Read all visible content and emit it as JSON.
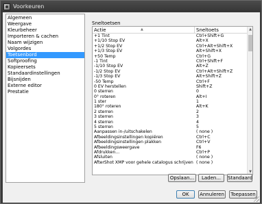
{
  "window": {
    "title": "Voorkeuren"
  },
  "sidebar": {
    "items": [
      {
        "label": "Algemeen"
      },
      {
        "label": "Weergave"
      },
      {
        "label": "Kleurbeheer"
      },
      {
        "label": "Importeren & cachen"
      },
      {
        "label": "Naam wijzigen"
      },
      {
        "label": "Volgordes"
      },
      {
        "label": "Toetsenbord",
        "selected": true
      },
      {
        "label": "Softproofing"
      },
      {
        "label": "Kopieersets"
      },
      {
        "label": "Standaardinstellingen"
      },
      {
        "label": "Bijsnijden"
      },
      {
        "label": "Externe editor"
      },
      {
        "label": "Prestatie"
      }
    ]
  },
  "main": {
    "section_title": "Sneltoetsen",
    "table": {
      "headers": {
        "action": "Actie",
        "shortcut": "Sneltoets"
      },
      "rows": [
        {
          "action": "+1 Tint",
          "shortcut": "Ctrl+Shift+G"
        },
        {
          "action": "+1/10 Stop EV",
          "shortcut": "Alt+X"
        },
        {
          "action": "+1/2 Stop EV",
          "shortcut": "Ctrl+Alt+Shift+X"
        },
        {
          "action": "+1/3 Stop EV",
          "shortcut": "Alt+Shift+X"
        },
        {
          "action": "+50 Temp",
          "shortcut": "Ctrl+G"
        },
        {
          "action": "-1 Tint",
          "shortcut": "Ctrl+Shift+F"
        },
        {
          "action": "-1/10 Stop EV",
          "shortcut": "Alt+Z"
        },
        {
          "action": "-1/2 Stop EV",
          "shortcut": "Ctrl+Alt+Shift+Z"
        },
        {
          "action": "-1/3 Stop EV",
          "shortcut": "Alt+Shift+Z"
        },
        {
          "action": "-50 Temp",
          "shortcut": "Ctrl+F"
        },
        {
          "action": "0 EV herstellen",
          "shortcut": "Shift+Z"
        },
        {
          "action": "0 sterren",
          "shortcut": "0"
        },
        {
          "action": "0° roteren",
          "shortcut": "Alt+I"
        },
        {
          "action": "1 ster",
          "shortcut": "1"
        },
        {
          "action": "180° roteren",
          "shortcut": "Alt+K"
        },
        {
          "action": "2 sterren",
          "shortcut": "2"
        },
        {
          "action": "3 sterren",
          "shortcut": "3"
        },
        {
          "action": "4 sterren",
          "shortcut": "4"
        },
        {
          "action": "5 sterren",
          "shortcut": "5"
        },
        {
          "action": "Aanpassen in-/uitschakelen",
          "shortcut": "( none )"
        },
        {
          "action": "Afbeeldingsinstellingen kopiëren",
          "shortcut": "Ctrl+C"
        },
        {
          "action": "Afbeeldingsinstellingen plakken",
          "shortcut": "Ctrl+V"
        },
        {
          "action": "Afbeeldingsweergave",
          "shortcut": "F6"
        },
        {
          "action": "Afdrukken...",
          "shortcut": "Ctrl+P"
        },
        {
          "action": "Afsluiten",
          "shortcut": "( none )"
        },
        {
          "action": "AfterShot XMP voor gehele catalogus schrijven",
          "shortcut": "( none )"
        }
      ]
    },
    "buttons": {
      "open": "Opslaan...",
      "load": "Laden...",
      "standard": "Standaard",
      "ok": "OK",
      "cancel": "Annuleren",
      "apply": "Toepassen"
    }
  },
  "colors": {
    "selection": "#3399ff",
    "titlebar": "#3a3a3a"
  }
}
